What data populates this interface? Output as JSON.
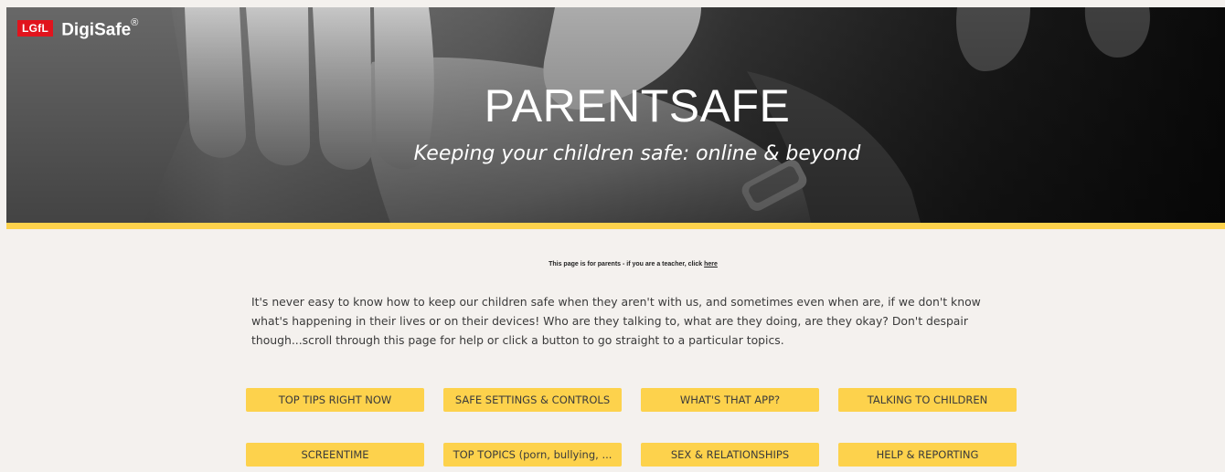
{
  "brand": {
    "badge": "LGfL",
    "name": "DigiSafe",
    "registered": "®"
  },
  "hero": {
    "title": "PARENTSAFE",
    "subtitle": "Keeping your children safe: online & beyond"
  },
  "notice": {
    "text": "This page is for parents - if you are a teacher, click ",
    "link_label": "here"
  },
  "intro": "It's never easy to know how to keep our children safe when they aren't with us, and sometimes even when are, if we don't know what's happening in their lives or on their devices! Who are they talking to, what are they doing, are they okay? Don't despair though...scroll through this page for help or click a button to go straight to a particular topics.",
  "buttons": {
    "row1": [
      "TOP TIPS RIGHT NOW",
      "SAFE SETTINGS & CONTROLS",
      "WHAT'S THAT APP?",
      "TALKING TO CHILDREN"
    ],
    "row2": [
      "SCREENTIME",
      "TOP TOPICS (porn, bullying, ...",
      "SEX & RELATIONSHIPS",
      "HELP & REPORTING"
    ]
  },
  "colors": {
    "accent_yellow": "#fdd24c",
    "brand_red": "#e1141d",
    "page_background": "#f4f1ee"
  }
}
